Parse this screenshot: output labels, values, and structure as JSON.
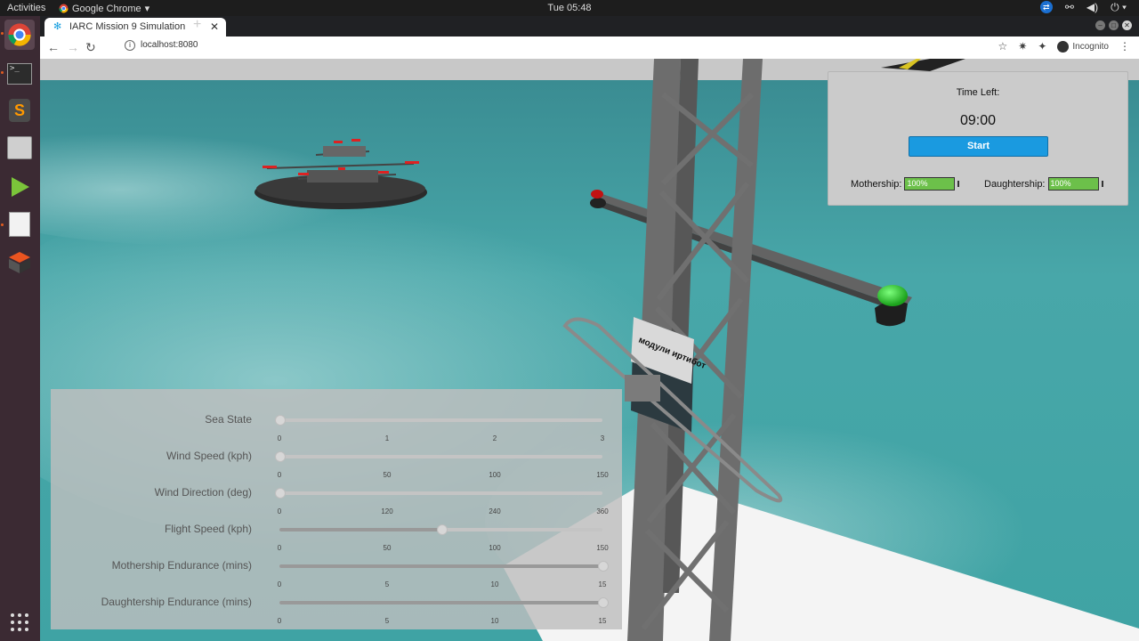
{
  "topbar": {
    "activities": "Activities",
    "app_name": "Google Chrome",
    "clock": "Tue 05:48"
  },
  "browser": {
    "tab_title": "IARC Mission 9 Simulation",
    "url": "localhost:8080",
    "incognito_label": "Incognito"
  },
  "timer_panel": {
    "label": "Time Left:",
    "time": "09:00",
    "start_label": "Start",
    "mothership_label": "Mothership:",
    "mothership_battery": "100%",
    "mothership_level": 1.0,
    "daughtership_label": "Daughtership:",
    "daughtership_battery": "100%",
    "daughtership_level": 1.0
  },
  "scene": {
    "tower_sign_text": "модули иртибот"
  },
  "settings": {
    "sliders": [
      {
        "label": "Sea State",
        "ticks": [
          "0",
          "1",
          "2",
          "3"
        ],
        "min": 0,
        "max": 3,
        "value": 0
      },
      {
        "label": "Wind Speed (kph)",
        "ticks": [
          "0",
          "50",
          "100",
          "150"
        ],
        "min": 0,
        "max": 150,
        "value": 0
      },
      {
        "label": "Wind Direction (deg)",
        "ticks": [
          "0",
          "120",
          "240",
          "360"
        ],
        "min": 0,
        "max": 360,
        "value": 0
      },
      {
        "label": "Flight Speed (kph)",
        "ticks": [
          "0",
          "50",
          "100",
          "150"
        ],
        "min": 0,
        "max": 150,
        "value": 75
      },
      {
        "label": "Mothership Endurance (mins)",
        "ticks": [
          "0",
          "5",
          "10",
          "15"
        ],
        "min": 0,
        "max": 15,
        "value": 15
      },
      {
        "label": "Daughtership Endurance (mins)",
        "ticks": [
          "0",
          "5",
          "10",
          "15"
        ],
        "min": 0,
        "max": 15,
        "value": 15
      }
    ]
  }
}
